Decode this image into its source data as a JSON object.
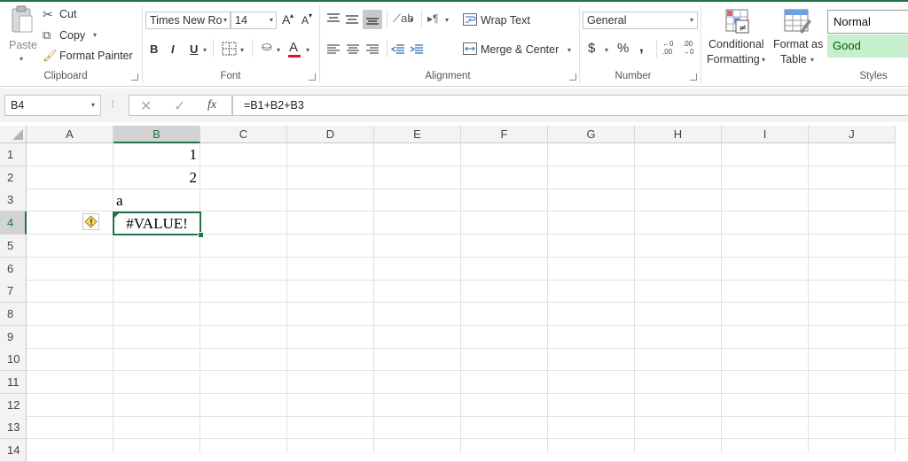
{
  "clipboard": {
    "paste_label": "Paste",
    "cut_label": "Cut",
    "copy_label": "Copy",
    "format_painter_label": "Format Painter",
    "group_label": "Clipboard"
  },
  "font": {
    "font_name": "Times New Ro",
    "font_size": "14",
    "grow_label": "A",
    "shrink_label": "A",
    "bold_label": "B",
    "italic_label": "I",
    "underline_label": "U",
    "font_color_label": "A",
    "group_label": "Font"
  },
  "alignment": {
    "wrap_text_label": "Wrap Text",
    "merge_center_label": "Merge & Center",
    "group_label": "Alignment"
  },
  "number": {
    "format_value": "General",
    "currency_label": "$",
    "percent_label": "%",
    "comma_label": ",",
    "inc_decimal_label": "⁀0\n.00",
    "group_label": "Number"
  },
  "styles": {
    "conditional_formatting_line1": "Conditional",
    "conditional_formatting_line2": "Formatting",
    "format_as_table_line1": "Format as",
    "format_as_table_line2": "Table",
    "normal_label": "Normal",
    "good_label": "Good",
    "group_label": "Styles",
    "good_bg": "#c6efce",
    "good_fg": "#006100"
  },
  "formula_bar": {
    "name_box": "B4",
    "cancel_icon": "✕",
    "enter_icon": "✓",
    "fx_label": "fx",
    "formula": "=B1+B2+B3"
  },
  "grid": {
    "columns": [
      "A",
      "B",
      "C",
      "D",
      "E",
      "F",
      "G",
      "H",
      "I",
      "J"
    ],
    "rows": [
      "1",
      "2",
      "3",
      "4",
      "5",
      "6",
      "7",
      "8",
      "9",
      "10",
      "11",
      "12",
      "13",
      "14"
    ],
    "cells": {
      "B1": "1",
      "B2": "2",
      "B3": "a",
      "B4": "#VALUE!"
    },
    "error_icon": "!"
  },
  "colors": {
    "accent": "#217346"
  }
}
